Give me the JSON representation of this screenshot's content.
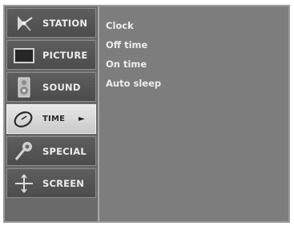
{
  "menu": {
    "items": [
      {
        "label": "STATION",
        "icon": "station-icon",
        "selected": false
      },
      {
        "label": "PICTURE",
        "icon": "picture-icon",
        "selected": false
      },
      {
        "label": "SOUND",
        "icon": "speaker-icon",
        "selected": false
      },
      {
        "label": "TIME",
        "icon": "clock-icon",
        "selected": true
      },
      {
        "label": "SPECIAL",
        "icon": "special-icon",
        "selected": false
      },
      {
        "label": "SCREEN",
        "icon": "screen-icon",
        "selected": false
      }
    ],
    "selected_arrow": "►"
  },
  "submenu": {
    "items": [
      "Clock",
      "Off time",
      "On time",
      "Auto sleep"
    ]
  }
}
